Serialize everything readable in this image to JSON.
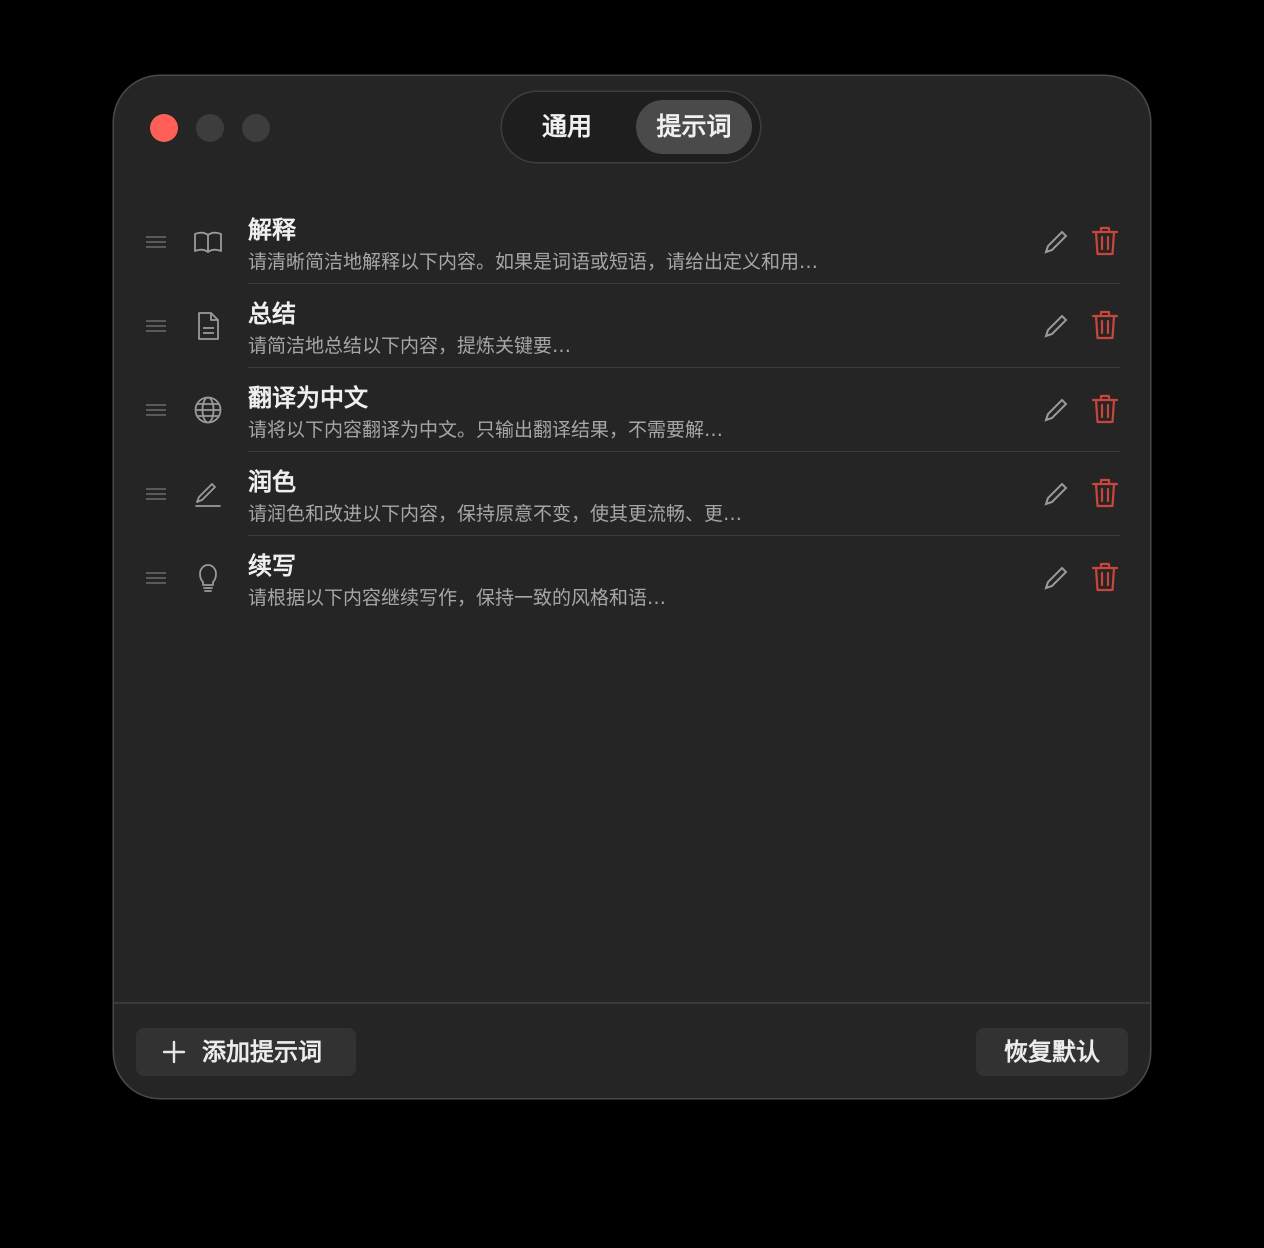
{
  "tabs": [
    {
      "label": "通用",
      "selected": false
    },
    {
      "label": "提示词",
      "selected": true
    }
  ],
  "prompts": [
    {
      "title": "解释",
      "description": "请清晰简洁地解释以下内容。如果是词语或短语，请给出定义和用…",
      "icon": "book-icon"
    },
    {
      "title": "总结",
      "description": "请简洁地总结以下内容，提炼关键要…",
      "icon": "document-icon"
    },
    {
      "title": "翻译为中文",
      "description": "请将以下内容翻译为中文。只输出翻译结果，不需要解…",
      "icon": "globe-icon"
    },
    {
      "title": "润色",
      "description": "请润色和改进以下内容，保持原意不变，使其更流畅、更…",
      "icon": "pen-icon"
    },
    {
      "title": "续写",
      "description": "请根据以下内容继续写作，保持一致的风格和语…",
      "icon": "lightbulb-icon"
    }
  ],
  "footer": {
    "add_label": "添加提示词",
    "restore_label": "恢复默认"
  },
  "colors": {
    "close": "#ff5f57",
    "delete": "#c9463d",
    "selected_tab": "#4a4a4a"
  }
}
